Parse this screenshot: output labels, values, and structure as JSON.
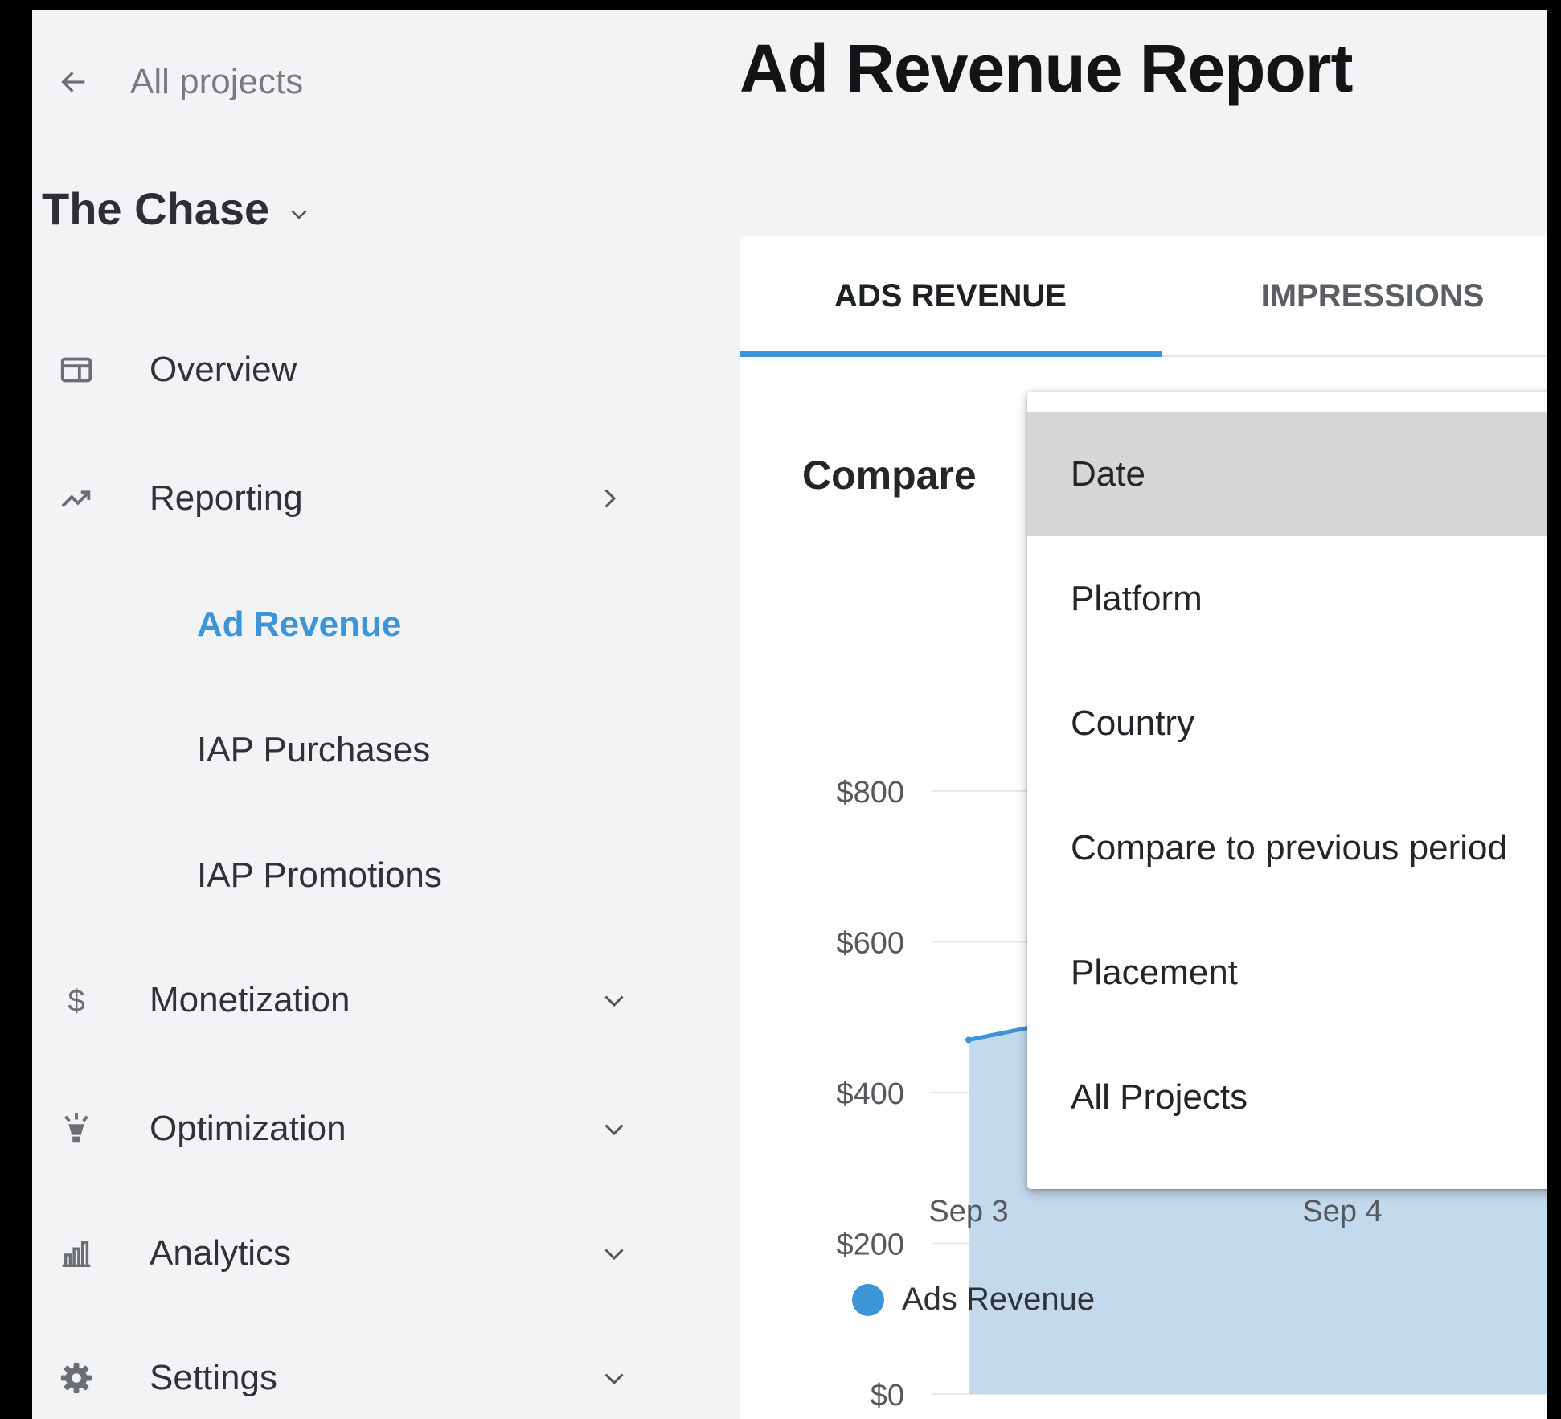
{
  "sidebar": {
    "back_label": "All projects",
    "project_name": "The Chase",
    "nav": [
      {
        "label": "Overview",
        "icon": "dashboard-icon"
      },
      {
        "label": "Reporting",
        "icon": "trending-up-icon"
      },
      {
        "label": "Monetization",
        "icon": "dollar-icon"
      },
      {
        "label": "Optimization",
        "icon": "lightbulb-icon"
      },
      {
        "label": "Analytics",
        "icon": "bar-chart-icon"
      },
      {
        "label": "Settings",
        "icon": "gear-icon"
      }
    ],
    "reporting_sub": [
      {
        "label": "Ad Revenue",
        "active": true
      },
      {
        "label": "IAP Purchases",
        "active": false
      },
      {
        "label": "IAP Promotions",
        "active": false
      }
    ]
  },
  "main": {
    "title": "Ad Revenue Report",
    "tabs": [
      {
        "label": "ADS REVENUE",
        "active": true
      },
      {
        "label": "IMPRESSIONS",
        "active": false
      }
    ],
    "compare_label": "Compare",
    "dropdown": {
      "items": [
        "Date",
        "Platform",
        "Country",
        "Compare to previous period",
        "Placement",
        "All Projects"
      ],
      "highlighted": "Date"
    },
    "legend_label": "Ads Revenue"
  },
  "colors": {
    "accent": "#3d94d6",
    "area_fill": "#c3d9ec",
    "sidebar_bg": "#f2f3f5"
  },
  "chart_data": {
    "type": "area",
    "x": [
      "Sep 3",
      "Sep 4"
    ],
    "series": [
      {
        "name": "Ads Revenue",
        "values": [
          470,
          570
        ]
      }
    ],
    "y_ticks": [
      "$0",
      "$200",
      "$400",
      "$600",
      "$800"
    ],
    "ylim": [
      0,
      800
    ],
    "grid": true,
    "legend": "bottom-left"
  }
}
